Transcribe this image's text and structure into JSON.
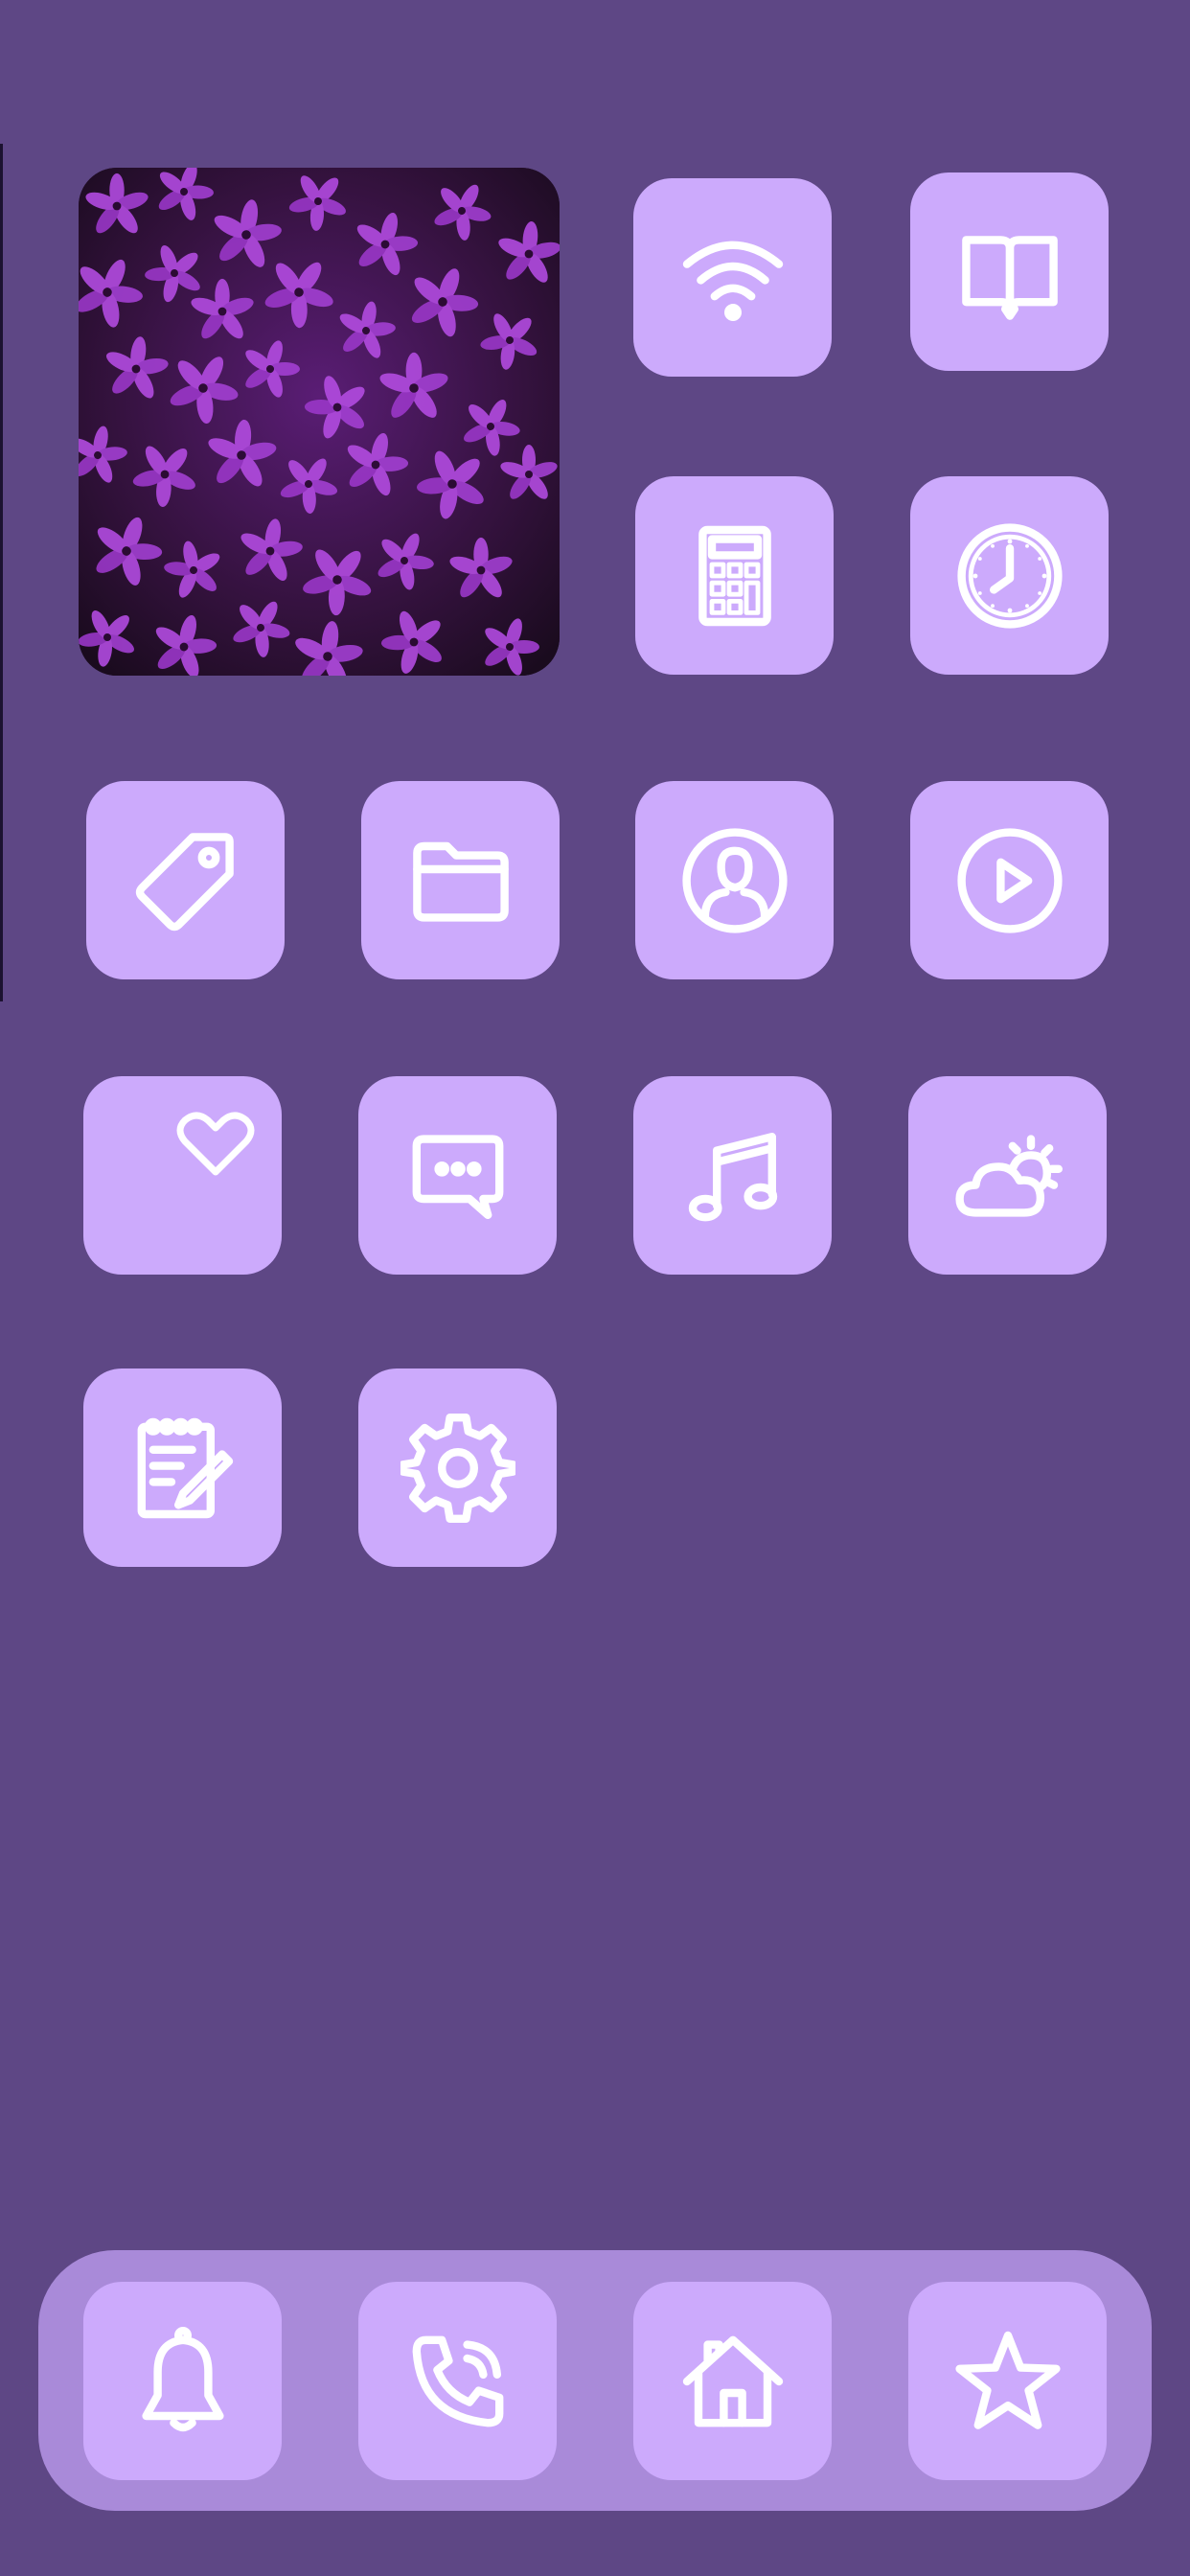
{
  "home_screen": {
    "wallpaper_color": "#5e4785",
    "app_tile_color": "#ccaafc",
    "icon_color": "#ffffff",
    "photo_widget": {
      "subject": "purple flowers"
    },
    "apps": [
      {
        "icon": "wifi-icon"
      },
      {
        "icon": "book-icon"
      },
      {
        "icon": "calculator-icon"
      },
      {
        "icon": "clock-icon"
      },
      {
        "icon": "tag-icon"
      },
      {
        "icon": "folder-icon"
      },
      {
        "icon": "contact-icon"
      },
      {
        "icon": "play-icon"
      },
      {
        "icon": "heart-icon"
      },
      {
        "icon": "message-icon"
      },
      {
        "icon": "music-icon"
      },
      {
        "icon": "weather-icon"
      },
      {
        "icon": "notes-icon"
      },
      {
        "icon": "settings-gear-icon"
      }
    ]
  },
  "dock": {
    "background_color": "#a98ad9",
    "apps": [
      {
        "icon": "bell-icon"
      },
      {
        "icon": "phone-icon"
      },
      {
        "icon": "home-icon"
      },
      {
        "icon": "star-icon"
      }
    ]
  }
}
